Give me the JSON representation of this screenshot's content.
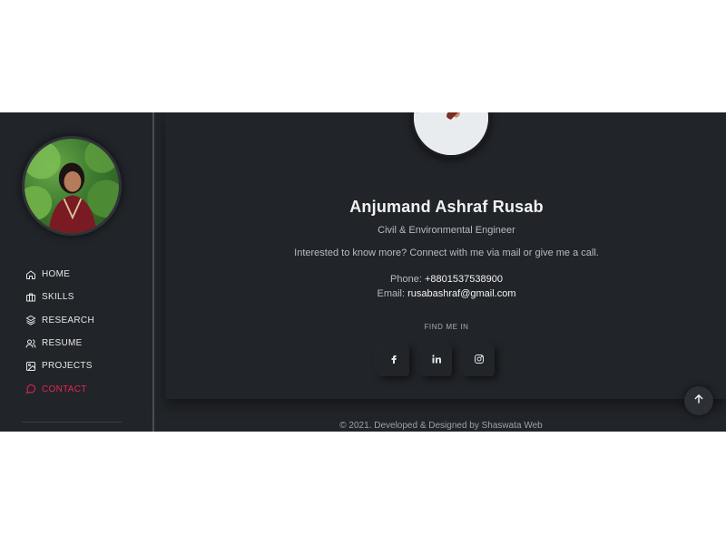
{
  "profile": {
    "name": "Anjumand Ashraf Rusab",
    "role": "Civil & Environmental Engineer",
    "pitch": "Interested to know more? Connect with me via mail or give me a call."
  },
  "contact": {
    "phone_label": "Phone:",
    "phone": "+8801537538900",
    "email_label": "Email:",
    "email": "rusabashraf@gmail.com"
  },
  "socials": {
    "heading": "FIND ME IN",
    "items": [
      {
        "name": "facebook",
        "icon": "facebook-icon"
      },
      {
        "name": "linkedin",
        "icon": "linkedin-icon"
      },
      {
        "name": "instagram",
        "icon": "instagram-icon"
      }
    ]
  },
  "nav": {
    "items": [
      {
        "label": "HOME",
        "icon": "home-icon"
      },
      {
        "label": "SKILLS",
        "icon": "briefcase-icon"
      },
      {
        "label": "RESEARCH",
        "icon": "layers-icon"
      },
      {
        "label": "RESUME",
        "icon": "users-icon"
      },
      {
        "label": "PROJECTS",
        "icon": "image-icon"
      },
      {
        "label": "CONTACT",
        "icon": "chat-icon",
        "active": true
      }
    ]
  },
  "footer": {
    "text": "© 2021. Developed & Designed by Shaswata Web"
  },
  "colors": {
    "background": "#212429",
    "accent": "#e6274d",
    "text": "#e7e7e7"
  }
}
